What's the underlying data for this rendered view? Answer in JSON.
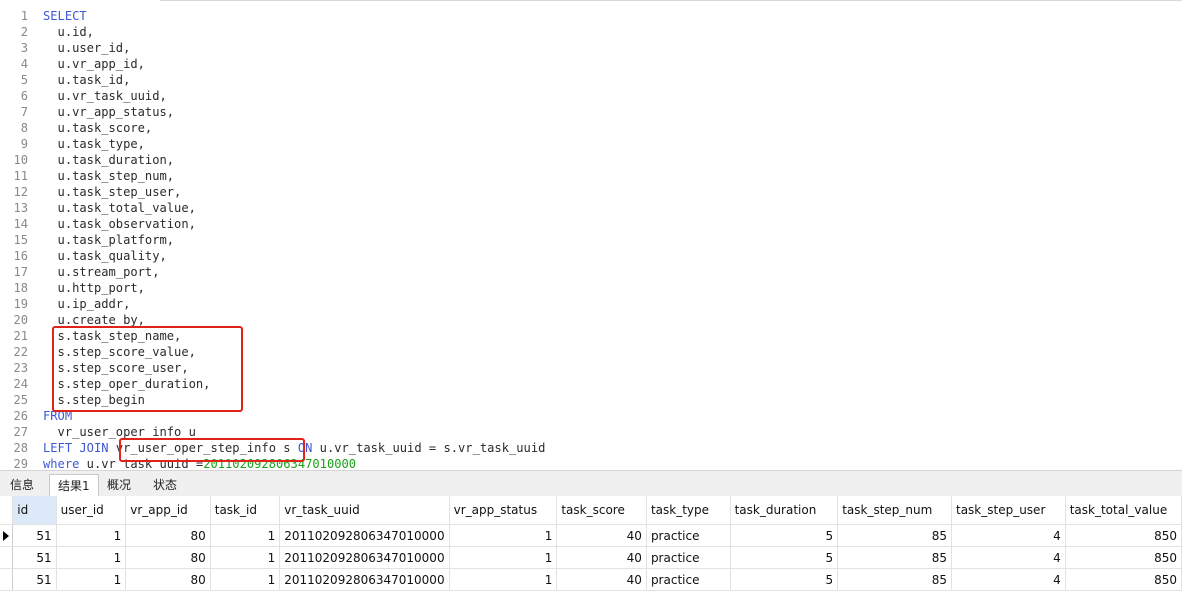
{
  "editor": {
    "line_numbers": [
      "1",
      "2",
      "3",
      "4",
      "5",
      "6",
      "7",
      "8",
      "9",
      "10",
      "11",
      "12",
      "13",
      "14",
      "15",
      "16",
      "17",
      "18",
      "19",
      "20",
      "21",
      "22",
      "23",
      "24",
      "25",
      "26",
      "27",
      "28",
      "29"
    ],
    "lines": [
      {
        "kw": "SELECT",
        "rest": ""
      },
      {
        "kw": "",
        "rest": "  u.id,"
      },
      {
        "kw": "",
        "rest": "  u.user_id,"
      },
      {
        "kw": "",
        "rest": "  u.vr_app_id,"
      },
      {
        "kw": "",
        "rest": "  u.task_id,"
      },
      {
        "kw": "",
        "rest": "  u.vr_task_uuid,"
      },
      {
        "kw": "",
        "rest": "  u.vr_app_status,"
      },
      {
        "kw": "",
        "rest": "  u.task_score,"
      },
      {
        "kw": "",
        "rest": "  u.task_type,"
      },
      {
        "kw": "",
        "rest": "  u.task_duration,"
      },
      {
        "kw": "",
        "rest": "  u.task_step_num,"
      },
      {
        "kw": "",
        "rest": "  u.task_step_user,"
      },
      {
        "kw": "",
        "rest": "  u.task_total_value,"
      },
      {
        "kw": "",
        "rest": "  u.task_observation,"
      },
      {
        "kw": "",
        "rest": "  u.task_platform,"
      },
      {
        "kw": "",
        "rest": "  u.task_quality,"
      },
      {
        "kw": "",
        "rest": "  u.stream_port,"
      },
      {
        "kw": "",
        "rest": "  u.http_port,"
      },
      {
        "kw": "",
        "rest": "  u.ip_addr,"
      },
      {
        "kw": "",
        "rest": "  u.create_by,"
      },
      {
        "kw": "",
        "rest": "  s.task_step_name,"
      },
      {
        "kw": "",
        "rest": "  s.step_score_value,"
      },
      {
        "kw": "",
        "rest": "  s.step_score_user,"
      },
      {
        "kw": "",
        "rest": "  s.step_oper_duration,"
      },
      {
        "kw": "",
        "rest": "  s.step_begin"
      },
      {
        "kw": "FROM",
        "rest": ""
      },
      {
        "kw": "",
        "rest": "  vr_user_oper_info u"
      }
    ],
    "line28": {
      "kw1": "LEFT JOIN",
      "table": "vr_user_oper_step_info",
      "mid": " s ",
      "kw2": "ON",
      "rest": " u.vr_task_uuid = s.vr_task_uuid"
    },
    "line29": {
      "kw": "where",
      "rest": " u.vr_task_uuid =",
      "value": "201102092806347010000"
    }
  },
  "tabs": [
    {
      "label": "信息",
      "active": false
    },
    {
      "label": "结果1",
      "active": true
    },
    {
      "label": "概况",
      "active": false
    },
    {
      "label": "状态",
      "active": false
    }
  ],
  "results": {
    "columns": [
      "id",
      "user_id",
      "vr_app_id",
      "task_id",
      "vr_task_uuid",
      "vr_app_status",
      "task_score",
      "task_type",
      "task_duration",
      "task_step_num",
      "task_step_user",
      "task_total_value"
    ],
    "rows": [
      [
        "51",
        "1",
        "80",
        "1",
        "201102092806347010000",
        "1",
        "40",
        "practice",
        "5",
        "85",
        "4",
        "850"
      ],
      [
        "51",
        "1",
        "80",
        "1",
        "201102092806347010000",
        "1",
        "40",
        "practice",
        "5",
        "85",
        "4",
        "850"
      ],
      [
        "51",
        "1",
        "80",
        "1",
        "201102092806347010000",
        "1",
        "40",
        "practice",
        "5",
        "85",
        "4",
        "850"
      ]
    ],
    "current_row": 0
  },
  "colors": {
    "keyword": "#3d57d8",
    "number": "#19a319",
    "highlight_box": "#e2231a",
    "header_selected": "#dbe9f8"
  }
}
